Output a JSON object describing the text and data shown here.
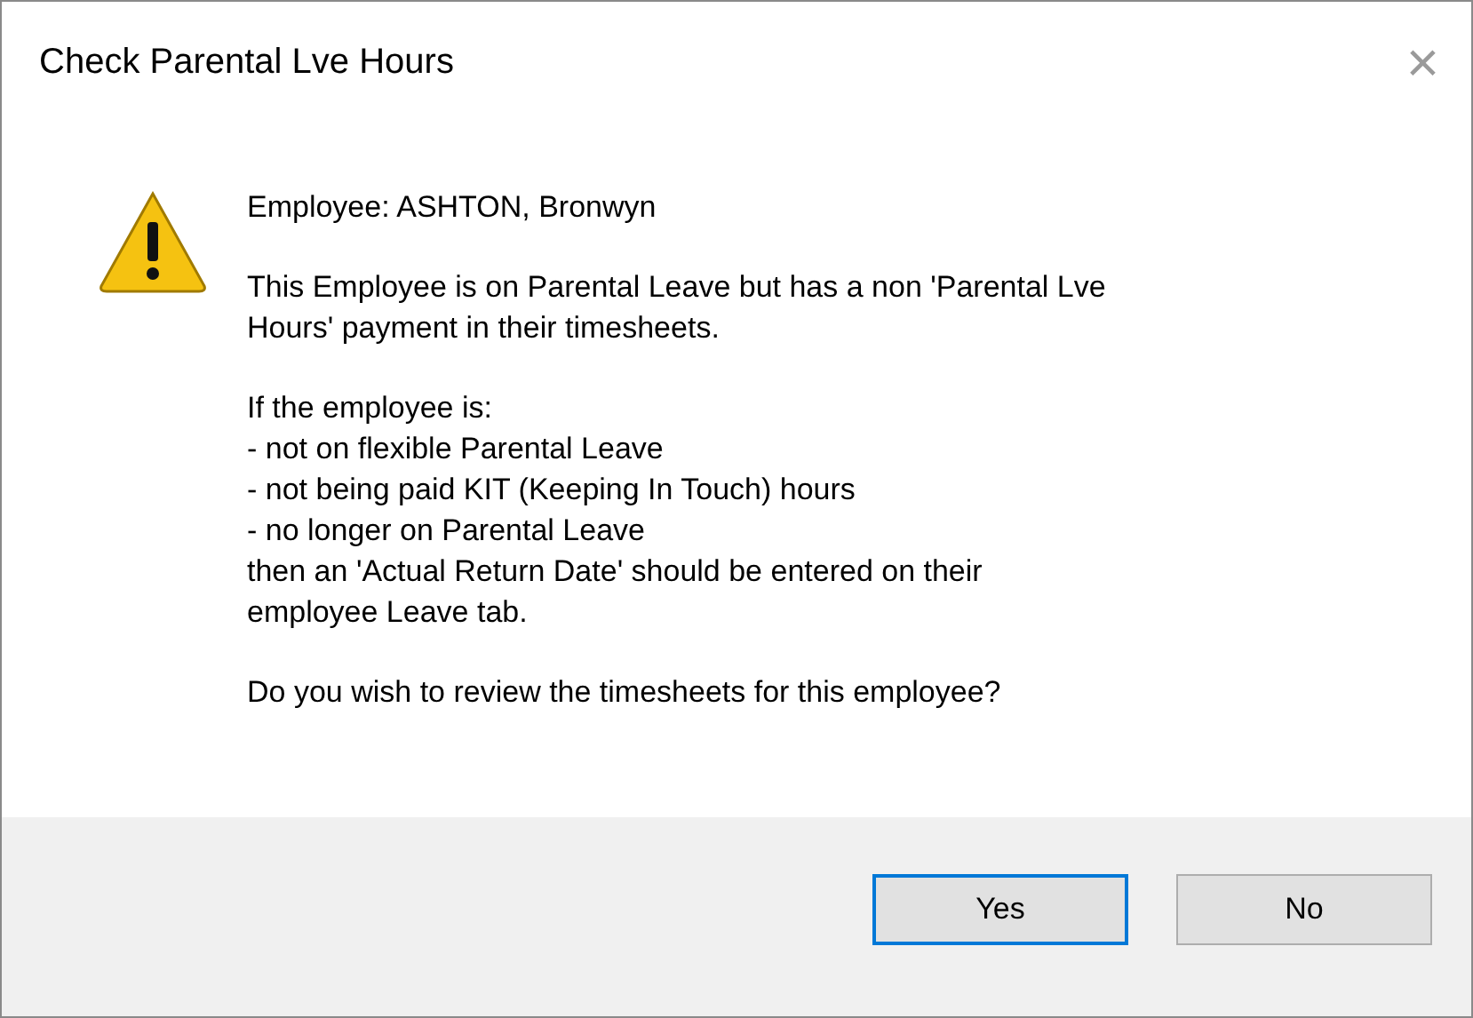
{
  "window": {
    "title": "Check Parental Lve Hours",
    "close": "×"
  },
  "message": {
    "paragraphs": [
      "Employee: ASHTON, Bronwyn",
      "This Employee is on Parental Leave but has a non 'Parental Lve\nHours' payment in their timesheets.",
      "If the employee is:\n- not on flexible Parental Leave\n- not being paid KIT (Keeping In Touch) hours\n- no longer on Parental Leave\nthen an 'Actual Return Date' should be entered on their\nemployee Leave tab.",
      "Do you wish to review the timesheets for this employee?"
    ]
  },
  "buttons": [
    {
      "label": "Yes",
      "selected": true
    },
    {
      "label": "No",
      "selected": false
    }
  ]
}
